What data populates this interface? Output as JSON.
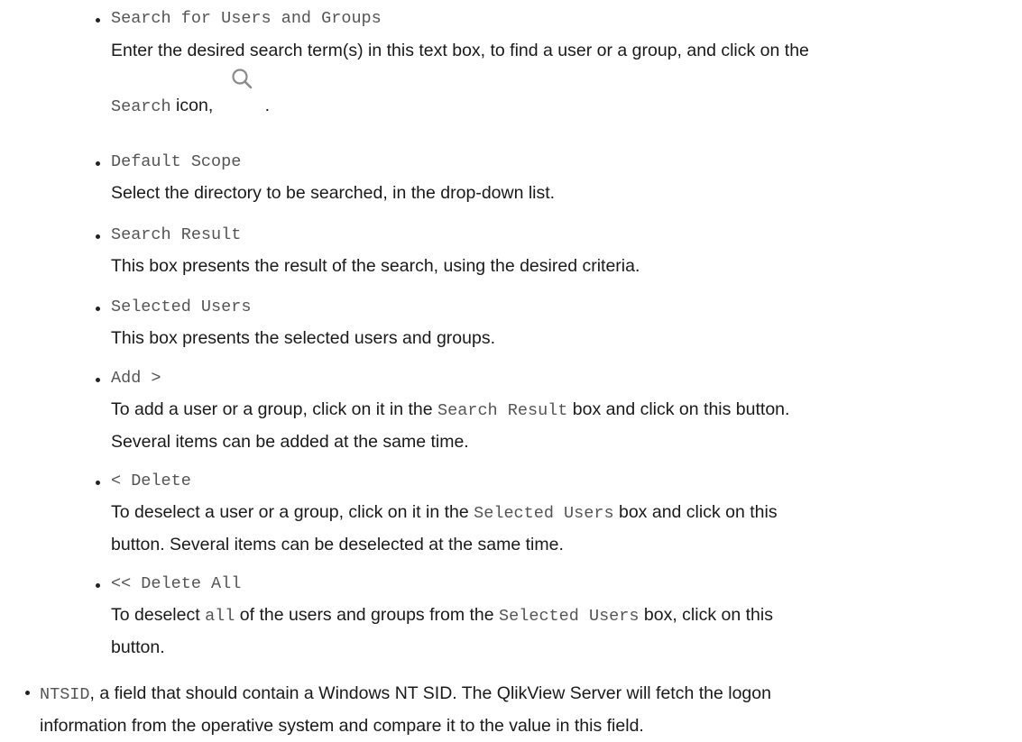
{
  "items": [
    {
      "term": "Search for Users and Groups",
      "desc_before": "Enter the desired search term(s) in this text box, to find a user or a group, and click on the",
      "desc_mono": "Search",
      "desc_after_mono": " icon,",
      "desc_end": "."
    },
    {
      "term": "Default Scope",
      "desc": "Select the directory to be searched, in the drop-down list."
    },
    {
      "term": "Search Result",
      "desc": "This box presents the result of the search, using the desired criteria."
    },
    {
      "term": "Selected Users",
      "desc": "This box presents the selected users and groups."
    },
    {
      "term": "Add >",
      "desc_before": "To add a user or a group, click on it in the ",
      "desc_mono": "Search Result",
      "desc_after": " box and click on this button.",
      "desc_line2": "Several items can be added at the same time."
    },
    {
      "term": "< Delete",
      "desc_before": "To deselect a user or a group, click on it in the ",
      "desc_mono": "Selected Users",
      "desc_after": " box and click on this",
      "desc_line2": "button. Several items can be deselected at the same time."
    },
    {
      "term": "<< Delete All",
      "desc_before": "To deselect ",
      "desc_mono": "all",
      "desc_mid": " of the users and groups from the ",
      "desc_mono2": "Selected Users",
      "desc_after": " box, click on this",
      "desc_line2": "button."
    }
  ],
  "outer": {
    "term": "NTSID",
    "text_line1": ", a field that should contain a Windows NT SID. The QlikView Server will fetch the logon",
    "text_line2": "information from the operative system and compare it to the value in this field."
  },
  "icons": {
    "search": "search-icon"
  }
}
